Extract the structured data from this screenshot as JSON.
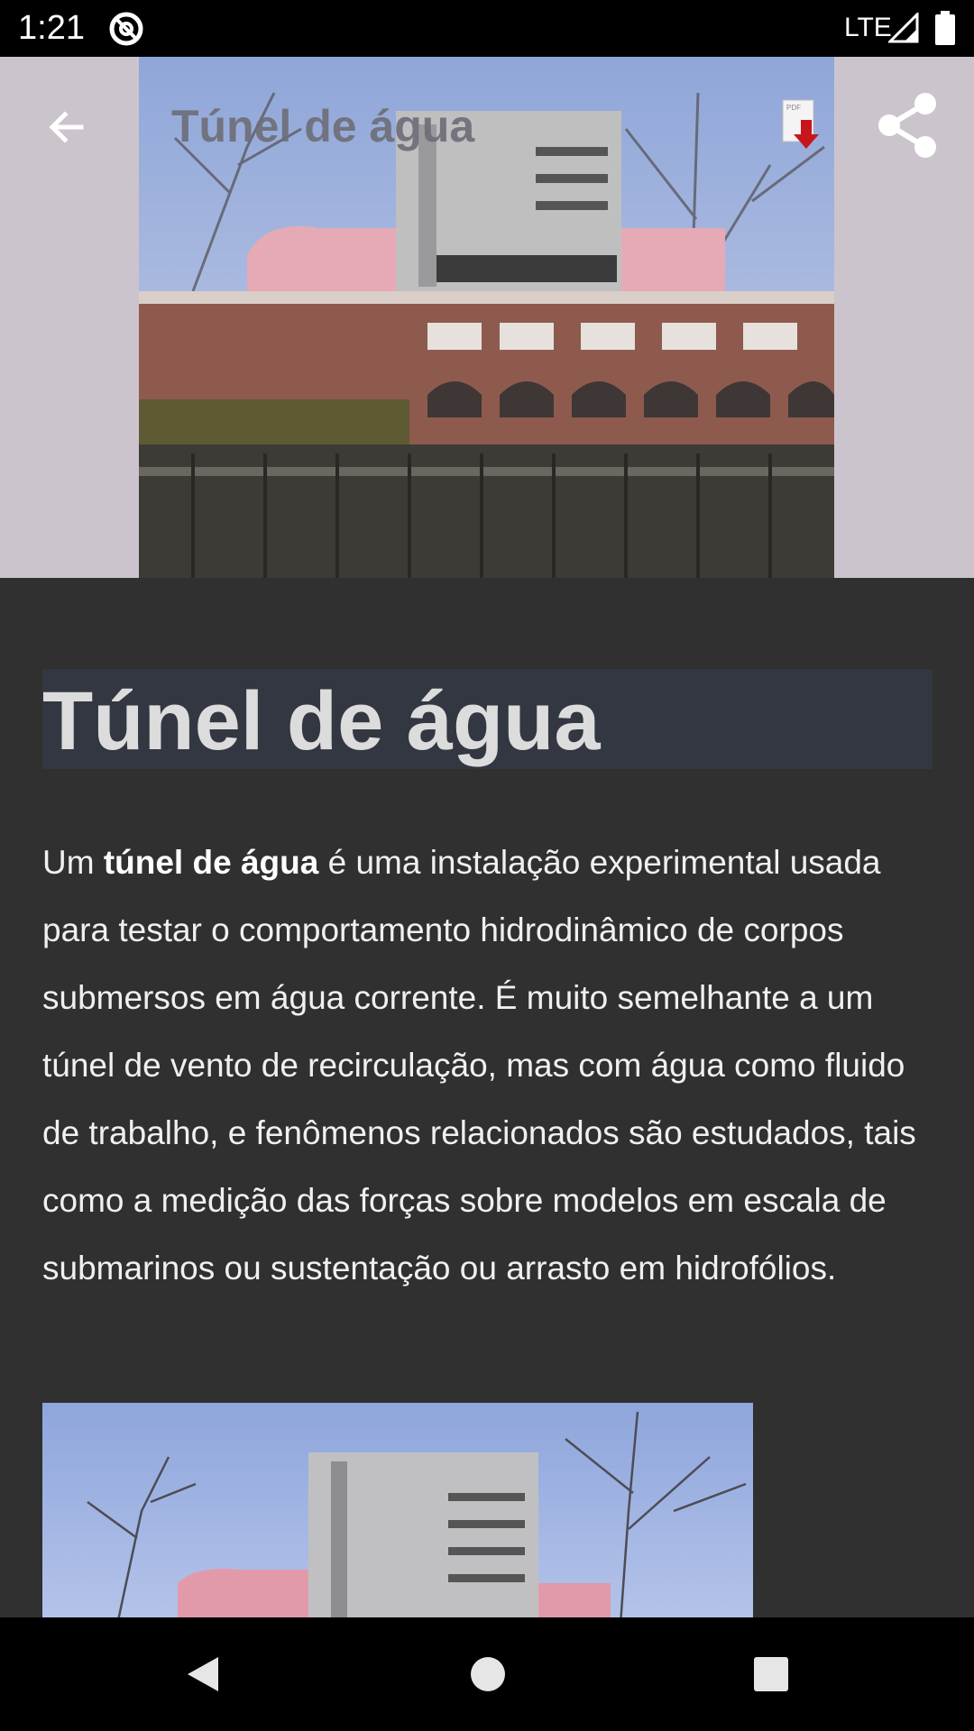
{
  "status_bar": {
    "time": "1:21",
    "network": "LTE"
  },
  "toolbar": {
    "title": "Túnel de água",
    "back_icon": "arrow-left-icon",
    "pdf_icon": "pdf-download-icon",
    "share_icon": "share-icon"
  },
  "article": {
    "title": "Túnel de água",
    "intro_prefix": "Um ",
    "intro_bold": "túnel de água",
    "intro_rest": " é uma instalação experimental usada para testar o comportamento hidrodinâmico de corpos submersos em água corrente. É muito semelhante a um túnel de vento de recirculação, mas com água como fluido de trabalho, e fenômenos relacionados são estudados, tais como a medição das forças sobre modelos em escala de submarinos ou sustentação ou arrasto em hidrofólios."
  },
  "nav_bar": {
    "back_icon": "triangle-back-icon",
    "home_icon": "circle-home-icon",
    "recents_icon": "square-recents-icon"
  },
  "colors": {
    "background": "#303030",
    "header_background": "#ccc4cc",
    "title_box": "#333741",
    "text": "#f0f0f0"
  }
}
